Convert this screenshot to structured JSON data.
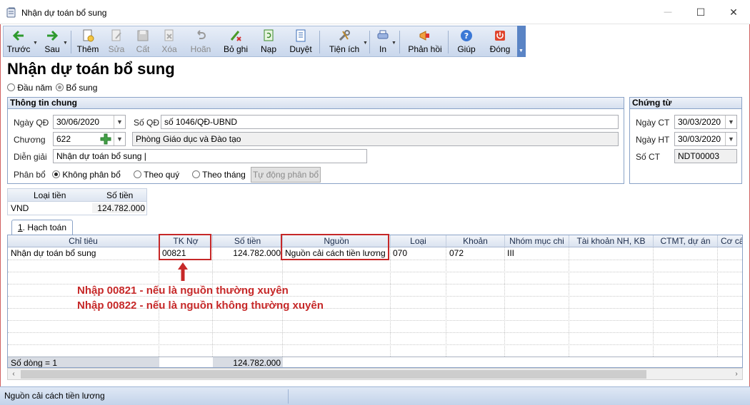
{
  "window": {
    "title": "Nhận dự toán bổ sung",
    "minimize_glyph": "—",
    "maximize_glyph": "☐",
    "close_glyph": "✕"
  },
  "toolbar": {
    "items": [
      {
        "label": "Trước",
        "icon": "arrow-left-icon",
        "enabled": true
      },
      {
        "label": "Sau",
        "icon": "arrow-right-icon",
        "enabled": true
      },
      {
        "label": "Thêm",
        "icon": "add-document-icon",
        "enabled": true
      },
      {
        "label": "Sửa",
        "icon": "edit-document-icon",
        "enabled": false
      },
      {
        "label": "Cất",
        "icon": "save-icon",
        "enabled": false
      },
      {
        "label": "Xóa",
        "icon": "delete-icon",
        "enabled": false
      },
      {
        "label": "Hoãn",
        "icon": "undo-icon",
        "enabled": false
      },
      {
        "label": "Bỏ ghi",
        "icon": "unpost-icon",
        "enabled": true
      },
      {
        "label": "Nạp",
        "icon": "reload-icon",
        "enabled": true
      },
      {
        "label": "Duyệt",
        "icon": "browse-icon",
        "enabled": true
      },
      {
        "label": "Tiện ích",
        "icon": "tools-icon",
        "enabled": true
      },
      {
        "label": "In",
        "icon": "print-icon",
        "enabled": true
      },
      {
        "label": "Phản hồi",
        "icon": "feedback-icon",
        "enabled": true
      },
      {
        "label": "Giúp",
        "icon": "help-icon",
        "enabled": true
      },
      {
        "label": "Đóng",
        "icon": "close-icon",
        "enabled": true
      }
    ]
  },
  "page_title": "Nhận dự toán bổ sung",
  "mode": {
    "options": [
      "Đầu năm",
      "Bổ sung"
    ],
    "selected": "Bổ sung"
  },
  "general_info": {
    "heading": "Thông tin chung",
    "ngay_qd_label": "Ngày QĐ",
    "ngay_qd_value": "30/06/2020",
    "so_qd_label": "Số QĐ",
    "so_qd_value": "số 1046/QĐ-UBND",
    "chuong_label": "Chương",
    "chuong_value": "622",
    "chuong_name": "Phòng Giáo dục và Đào tạo",
    "dien_giai_label": "Diễn giải",
    "dien_giai_value": "Nhận dự toán bổ sung |",
    "phan_bo_label": "Phân bổ",
    "phan_bo_options": [
      "Không phân bổ",
      "Theo quý",
      "Theo tháng"
    ],
    "phan_bo_selected": "Không phân bổ",
    "auto_allocate_label": "Tự động phân bổ"
  },
  "voucher": {
    "heading": "Chứng từ",
    "ngay_ct_label": "Ngày CT",
    "ngay_ct_value": "30/03/2020",
    "ngay_ht_label": "Ngày HT",
    "ngay_ht_value": "30/03/2020",
    "so_ct_label": "Số CT",
    "so_ct_value": "NDT00003"
  },
  "currency": {
    "headers": [
      "Loại tiền",
      "Số tiền"
    ],
    "row": [
      "VND",
      "124.782.000"
    ]
  },
  "tab": {
    "label_prefix": "1",
    "label": ". Hạch toán"
  },
  "grid": {
    "columns": [
      "Chỉ tiêu",
      "TK Nợ",
      "Số tiền",
      "Nguồn",
      "Loại",
      "Khoản",
      "Nhóm mục chi",
      "Tài khoản NH, KB",
      "CTMT, dự án",
      "Cơ cấu"
    ],
    "rows": [
      [
        "Nhận dự toán bổ sung",
        "00821",
        "124.782.000",
        "Nguồn cải cách tiền lương",
        "070",
        "072",
        "III",
        "",
        "",
        ""
      ]
    ],
    "footer_count": "Số dòng = 1",
    "footer_total": "124.782.000"
  },
  "annotation": {
    "line1": "Nhập 00821 - nếu là nguồn thường xuyên",
    "line2": "Nhập 00822 - nếu là nguồn không thường xuyên",
    "color": "#c62828"
  },
  "status": {
    "text": "Nguồn cải cách tiền lương"
  }
}
